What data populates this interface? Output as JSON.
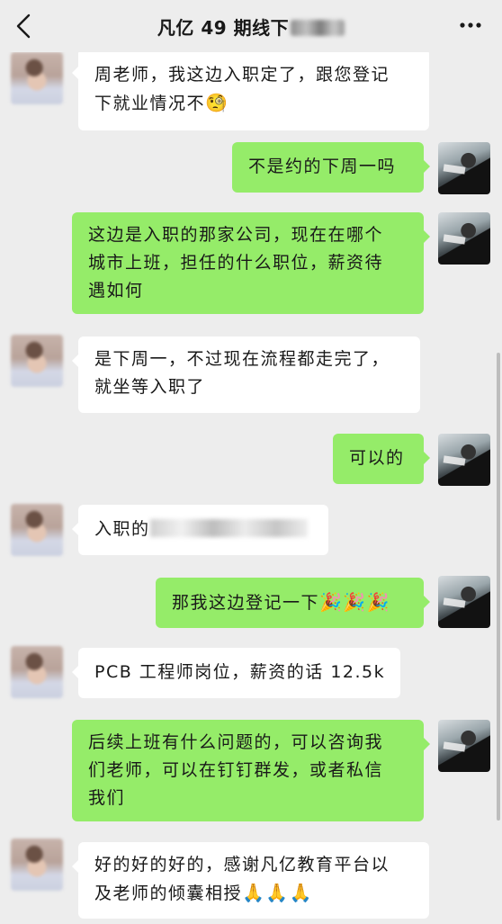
{
  "header": {
    "title": "凡亿 49 期线下"
  },
  "messages": [
    {
      "side": "left",
      "text1": "周老师，我这边入职定了，跟您登记",
      "text2": "下就业情况不",
      "emoji": "🧐"
    },
    {
      "side": "right",
      "text1": "不是约的下周一吗"
    },
    {
      "side": "right",
      "text1": "这边是入职的那家公司，现在在哪个",
      "text2": "城市上班，担任的什么职位，薪资待",
      "text3": "遇如何"
    },
    {
      "side": "left",
      "text1": "是下周一，不过现在流程都走完了，",
      "text2": "就坐等入职了"
    },
    {
      "side": "right",
      "text1": "可以的"
    },
    {
      "side": "left",
      "text1": "入职的"
    },
    {
      "side": "right",
      "text1": "那我这边登记一下",
      "emoji": "🎉🎉🎉"
    },
    {
      "side": "left",
      "text1": "PCB 工程师岗位，薪资的话 12.5k"
    },
    {
      "side": "right",
      "text1": "后续上班有什么问题的，可以咨询我",
      "text2": "们老师，可以在钉钉群发，或者私信",
      "text3": "我们"
    },
    {
      "side": "left",
      "text1": "好的好的好的，感谢凡亿教育平台以",
      "text2": "及老师的倾囊相授",
      "emoji": "🙏🙏🙏"
    }
  ]
}
